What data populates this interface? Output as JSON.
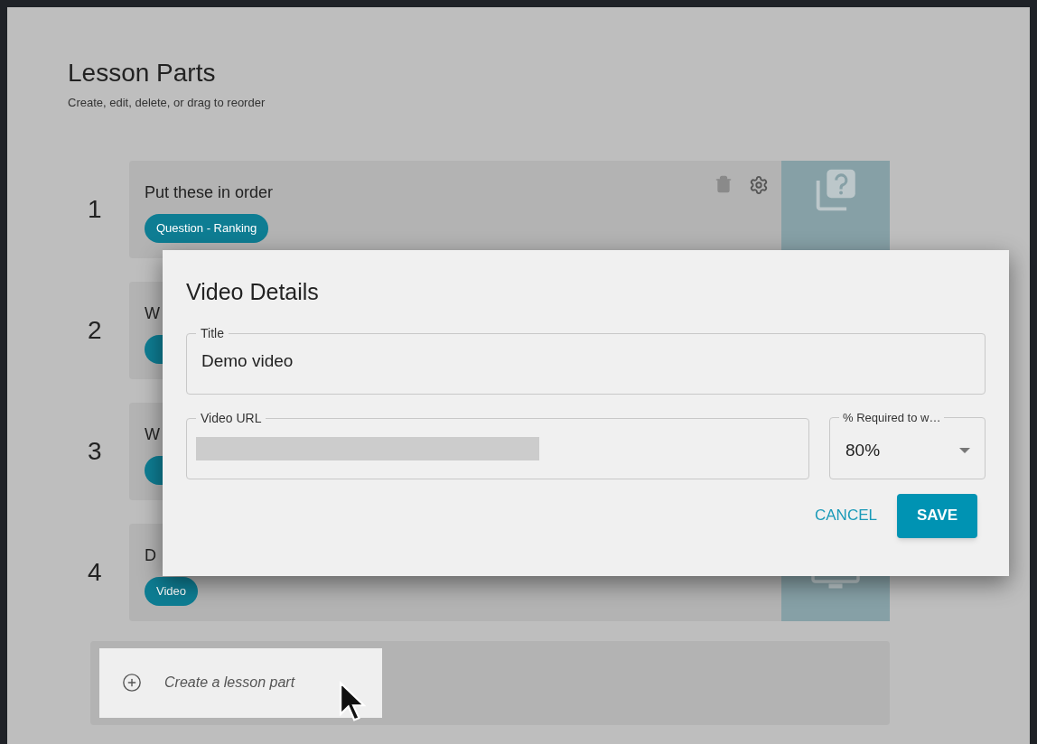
{
  "page": {
    "title": "Lesson Parts",
    "subtitle": "Create, edit, delete, or drag to reorder"
  },
  "parts": [
    {
      "number": "1",
      "title": "Put these in order",
      "tag": "Question - Ranking",
      "kind": "question"
    },
    {
      "number": "2",
      "title": "W",
      "kind": "plain"
    },
    {
      "number": "3",
      "title": "W",
      "kind": "plain"
    },
    {
      "number": "4",
      "title": "D",
      "tag": "Video",
      "kind": "video"
    }
  ],
  "create_button": {
    "label": "Create a lesson part"
  },
  "dialog": {
    "title": "Video Details",
    "fields": [
      {
        "label": "Title",
        "value": "Demo video"
      },
      {
        "label": "Video URL",
        "redacted": true
      }
    ],
    "select": {
      "label": "% Required to w…",
      "value": "80%"
    },
    "buttons": [
      {
        "label": "CANCEL",
        "kind": "text"
      },
      {
        "label": "SAVE",
        "kind": "primary"
      }
    ]
  }
}
